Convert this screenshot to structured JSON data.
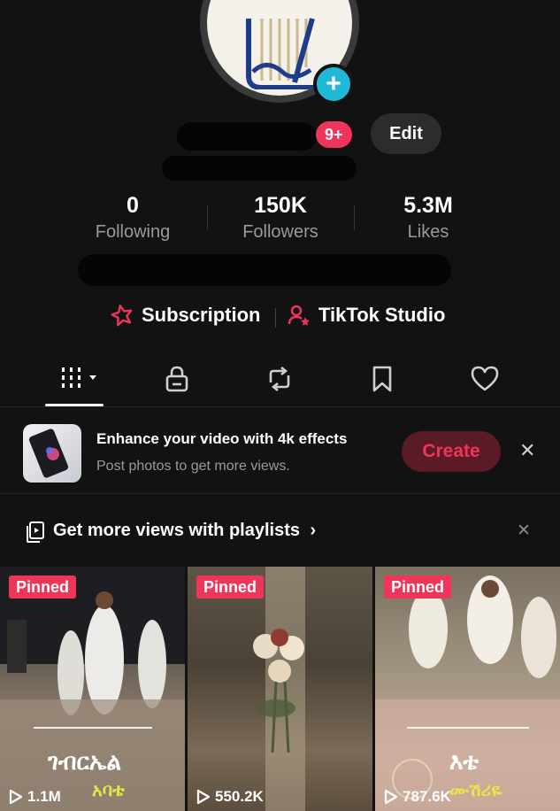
{
  "profile": {
    "notif_badge": "9+",
    "edit_label": "Edit"
  },
  "stats": [
    {
      "value": "0",
      "label": "Following"
    },
    {
      "value": "150K",
      "label": "Followers"
    },
    {
      "value": "5.3M",
      "label": "Likes"
    }
  ],
  "links": {
    "subscription": "Subscription",
    "studio": "TikTok Studio"
  },
  "tabs": [
    "grid-icon",
    "lock-icon",
    "repost-icon",
    "bookmark-icon",
    "heart-icon"
  ],
  "promo": {
    "title": "Enhance your video with 4k effects",
    "subtitle": "Post photos to get more views.",
    "create_label": "Create",
    "close": "✕"
  },
  "playlist": {
    "label": "Get more views with playlists",
    "chevron": "›",
    "close": "✕"
  },
  "videos": [
    {
      "pinned": "Pinned",
      "views": "1.1M",
      "caption_main": "ገብርኤል",
      "caption_sub": "አባቴ"
    },
    {
      "pinned": "Pinned",
      "views": "550.2K"
    },
    {
      "pinned": "Pinned",
      "views": "787.6K",
      "caption_main": "እቴ",
      "caption_sub": "ሙሽሪዬ"
    }
  ],
  "colors": {
    "accent": "#f0355a",
    "cyan": "#20b8d6",
    "background": "#121212"
  }
}
